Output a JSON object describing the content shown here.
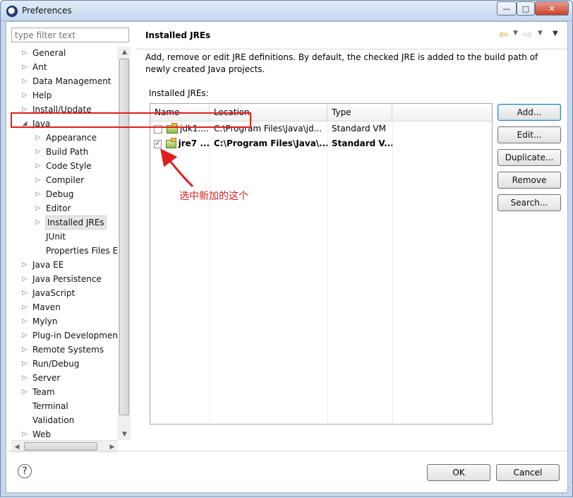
{
  "window": {
    "title": "Preferences",
    "controls": {
      "minimize": "—",
      "maximize": "□",
      "close": "✕"
    }
  },
  "sidebar": {
    "filter_placeholder": "type filter text",
    "tree": [
      {
        "label": "General",
        "depth": 0,
        "expander": "▷"
      },
      {
        "label": "Ant",
        "depth": 0,
        "expander": "▷"
      },
      {
        "label": "Data Management",
        "depth": 0,
        "expander": "▷"
      },
      {
        "label": "Help",
        "depth": 0,
        "expander": "▷"
      },
      {
        "label": "Install/Update",
        "depth": 0,
        "expander": "▷"
      },
      {
        "label": "Java",
        "depth": 0,
        "expander": "◢"
      },
      {
        "label": "Appearance",
        "depth": 1,
        "expander": "▷"
      },
      {
        "label": "Build Path",
        "depth": 1,
        "expander": "▷"
      },
      {
        "label": "Code Style",
        "depth": 1,
        "expander": "▷"
      },
      {
        "label": "Compiler",
        "depth": 1,
        "expander": "▷"
      },
      {
        "label": "Debug",
        "depth": 1,
        "expander": "▷"
      },
      {
        "label": "Editor",
        "depth": 1,
        "expander": "▷"
      },
      {
        "label": "Installed JREs",
        "depth": 1,
        "expander": "▷",
        "selected": true
      },
      {
        "label": "JUnit",
        "depth": 1,
        "expander": ""
      },
      {
        "label": "Properties Files Ed",
        "depth": 1,
        "expander": ""
      },
      {
        "label": "Java EE",
        "depth": 0,
        "expander": "▷"
      },
      {
        "label": "Java Persistence",
        "depth": 0,
        "expander": "▷"
      },
      {
        "label": "JavaScript",
        "depth": 0,
        "expander": "▷"
      },
      {
        "label": "Maven",
        "depth": 0,
        "expander": "▷"
      },
      {
        "label": "Mylyn",
        "depth": 0,
        "expander": "▷"
      },
      {
        "label": "Plug-in Development",
        "depth": 0,
        "expander": "▷"
      },
      {
        "label": "Remote Systems",
        "depth": 0,
        "expander": "▷"
      },
      {
        "label": "Run/Debug",
        "depth": 0,
        "expander": "▷"
      },
      {
        "label": "Server",
        "depth": 0,
        "expander": "▷"
      },
      {
        "label": "Team",
        "depth": 0,
        "expander": "▷"
      },
      {
        "label": "Terminal",
        "depth": 0,
        "expander": ""
      },
      {
        "label": "Validation",
        "depth": 0,
        "expander": ""
      },
      {
        "label": "Web",
        "depth": 0,
        "expander": "▷"
      }
    ],
    "vscroll": {
      "up": "▲",
      "down": "▼",
      "grip": "≡"
    },
    "hscroll": {
      "left": "◀",
      "right": "▶",
      "grip": "III"
    }
  },
  "page": {
    "title": "Installed JREs",
    "description": "Add, remove or edit JRE definitions. By default, the checked JRE is added to the build path of newly created Java projects.",
    "list_label": "Installed JREs:",
    "nav": {
      "back": "⇦",
      "back_drop": "▼",
      "forward": "⇨",
      "forward_drop": "▼",
      "menu": "▼"
    },
    "table": {
      "headers": [
        "Name",
        "Location",
        "Type"
      ],
      "rows": [
        {
          "checked": false,
          "check_mark": "",
          "name": "jdk1....",
          "location": "C:\\Program Files\\Java\\jd...",
          "type": "Standard VM"
        },
        {
          "checked": true,
          "check_mark": "✓",
          "name": "jre7 ...",
          "location": "C:\\Program Files\\Java\\...",
          "type": "Standard V..."
        }
      ]
    },
    "buttons": {
      "add": "Add...",
      "edit": "Edit...",
      "duplicate": "Duplicate...",
      "remove": "Remove",
      "search": "Search..."
    },
    "annotation": "选中新加的这个"
  },
  "footer": {
    "help": "?",
    "ok": "OK",
    "cancel": "Cancel"
  },
  "colors": {
    "accent": "#df1f1f",
    "selection": "#e6e6e6",
    "window_frame": "#c7d8ec"
  }
}
